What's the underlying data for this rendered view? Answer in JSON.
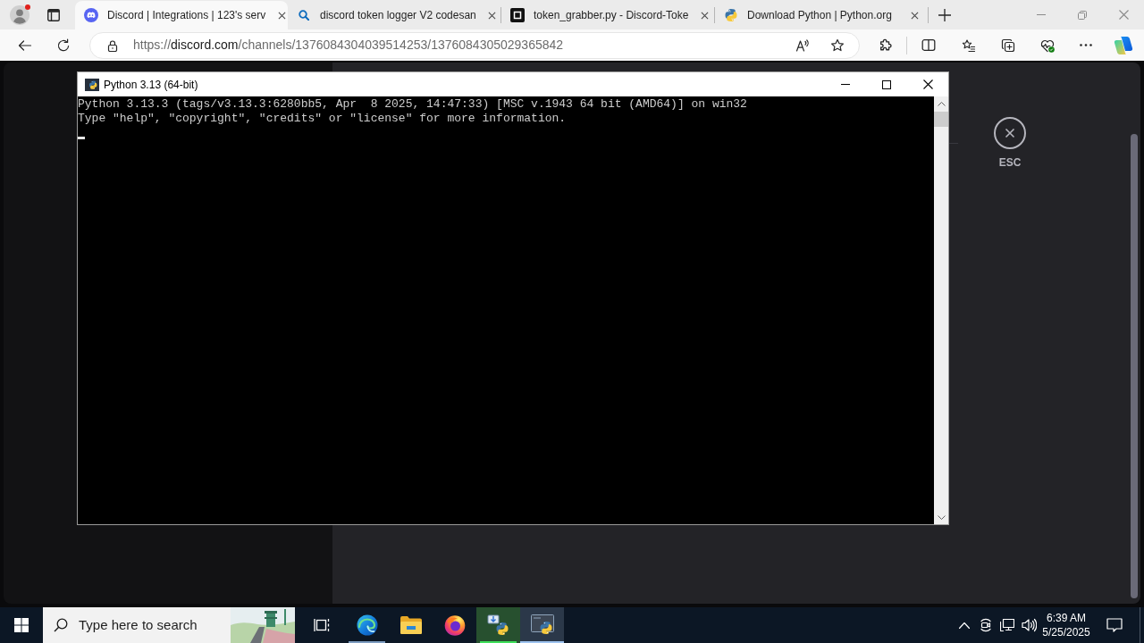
{
  "browser": {
    "profile": {
      "notification": true
    },
    "tabs": [
      {
        "title": "Discord | Integrations | 123's serv",
        "selected": true
      },
      {
        "title": "discord token logger V2 codesan",
        "selected": false
      },
      {
        "title": "token_grabber.py - Discord-Toke",
        "selected": false
      },
      {
        "title": "Download Python | Python.org",
        "selected": false
      }
    ],
    "address_bar": {
      "url": {
        "scheme": "https://",
        "host": "discord.com",
        "path": "/channels/1376084304039514253/1376084305029365842"
      }
    }
  },
  "page": {
    "close_button": {
      "label": "ESC"
    }
  },
  "console_window": {
    "title": "Python 3.13 (64-bit)",
    "lines": [
      "Python 3.13.3 (tags/v3.13.3:6280bb5, Apr  8 2025, 14:47:33) [MSC v.1943 64 bit (AMD64)] on win32",
      "Type \"help\", \"copyright\", \"credits\" or \"license\" for more information."
    ]
  },
  "taskbar": {
    "search": {
      "placeholder": "Type here to search"
    },
    "apps": [
      {
        "kind": "edge",
        "running": true,
        "selected": false
      },
      {
        "kind": "explorer",
        "running": false,
        "selected": false
      },
      {
        "kind": "firefox",
        "running": false,
        "selected": false
      },
      {
        "kind": "installer",
        "running": true,
        "selected": false,
        "level": 1
      },
      {
        "kind": "python",
        "running": true,
        "selected": true
      }
    ],
    "clock": {
      "time": "6:39 AM",
      "date": "5/25/2025"
    }
  }
}
